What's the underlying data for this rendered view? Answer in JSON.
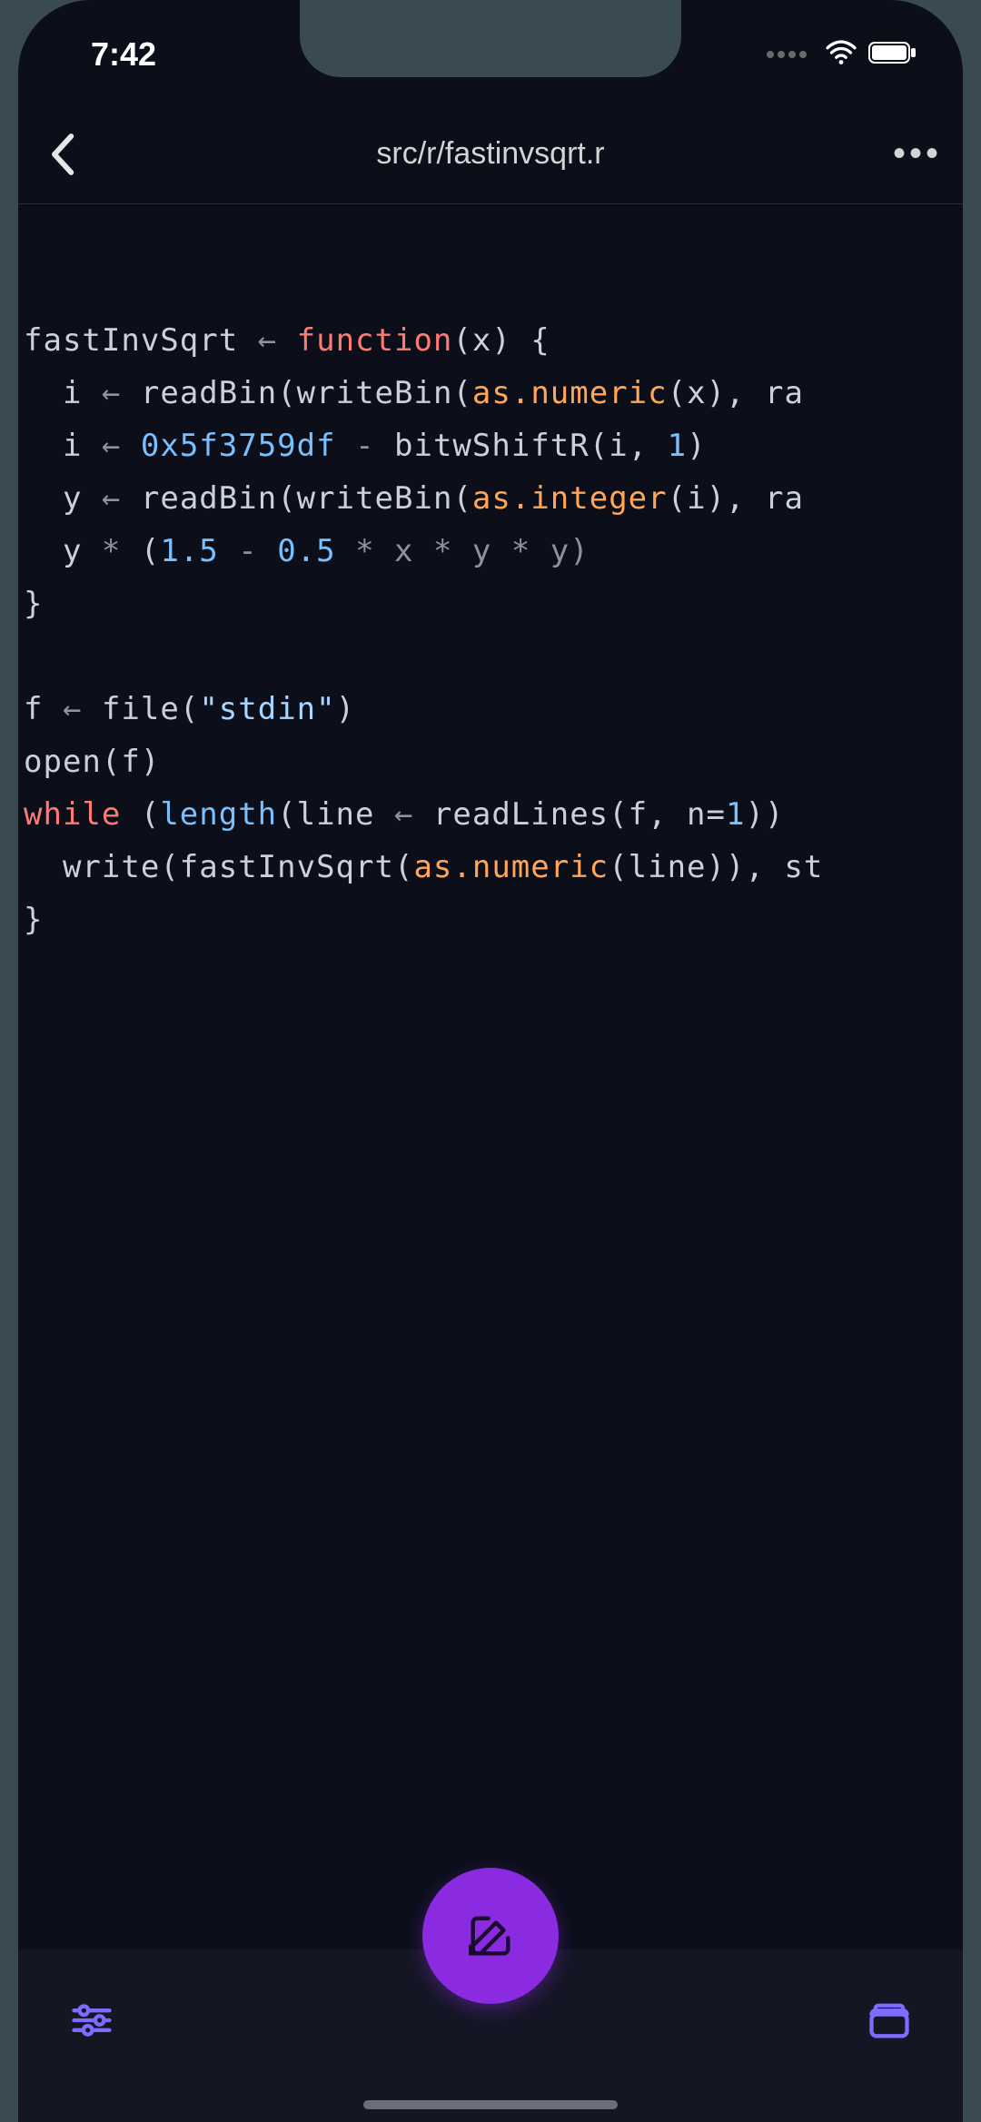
{
  "status": {
    "time": "7:42"
  },
  "nav": {
    "title": "src/r/fastinvsqrt.r"
  },
  "code": {
    "l1": {
      "name": "fastInvSqrt",
      "assign": "←",
      "kw": "function",
      "args": "(x) {"
    },
    "l2": {
      "indent": "  ",
      "var": "i",
      "assign": "←",
      "fn1": "readBin",
      "p1": "(",
      "fn2": "writeBin",
      "p2": "(",
      "type": "as.numeric",
      "rest": "(x), ra"
    },
    "l3": {
      "indent": "  ",
      "var": "i",
      "assign": "←",
      "hex": "0x5f3759df",
      "minus": " - ",
      "fn": "bitwShiftR",
      "p1": "(i, ",
      "num": "1",
      "p2": ")"
    },
    "l4": {
      "indent": "  ",
      "var": "y",
      "assign": "←",
      "fn1": "readBin",
      "p1": "(",
      "fn2": "writeBin",
      "p2": "(",
      "type": "as.integer",
      "rest": "(i), ra"
    },
    "l5": {
      "indent": "  ",
      "var": "y",
      "star1": " * ",
      "p1": "(",
      "n1": "1.5",
      "minus": " - ",
      "n2": "0.5",
      "rest": " * x * y * y)"
    },
    "l6": {
      "brace": "}"
    },
    "l7": {
      "blank": ""
    },
    "l8": {
      "var": "f",
      "assign": "←",
      "fn": "file",
      "p1": "(",
      "str": "\"stdin\"",
      "p2": ")"
    },
    "l9": {
      "fn": "open",
      "args": "(f)"
    },
    "l10": {
      "kw": "while",
      "sp": " (",
      "fn": "length",
      "p1": "(line ",
      "assign": "←",
      "fn2": " readLines",
      "p2": "(f, n=",
      "num": "1",
      "p3": ")) "
    },
    "l11": {
      "indent": "  ",
      "fn1": "write",
      "p1": "(",
      "fn2": "fastInvSqrt",
      "p2": "(",
      "type": "as.numeric",
      "rest": "(line)), st"
    },
    "l12": {
      "brace": "}"
    }
  },
  "colors": {
    "accent": "#8a2be2",
    "iconAccent": "#7c6cff"
  }
}
